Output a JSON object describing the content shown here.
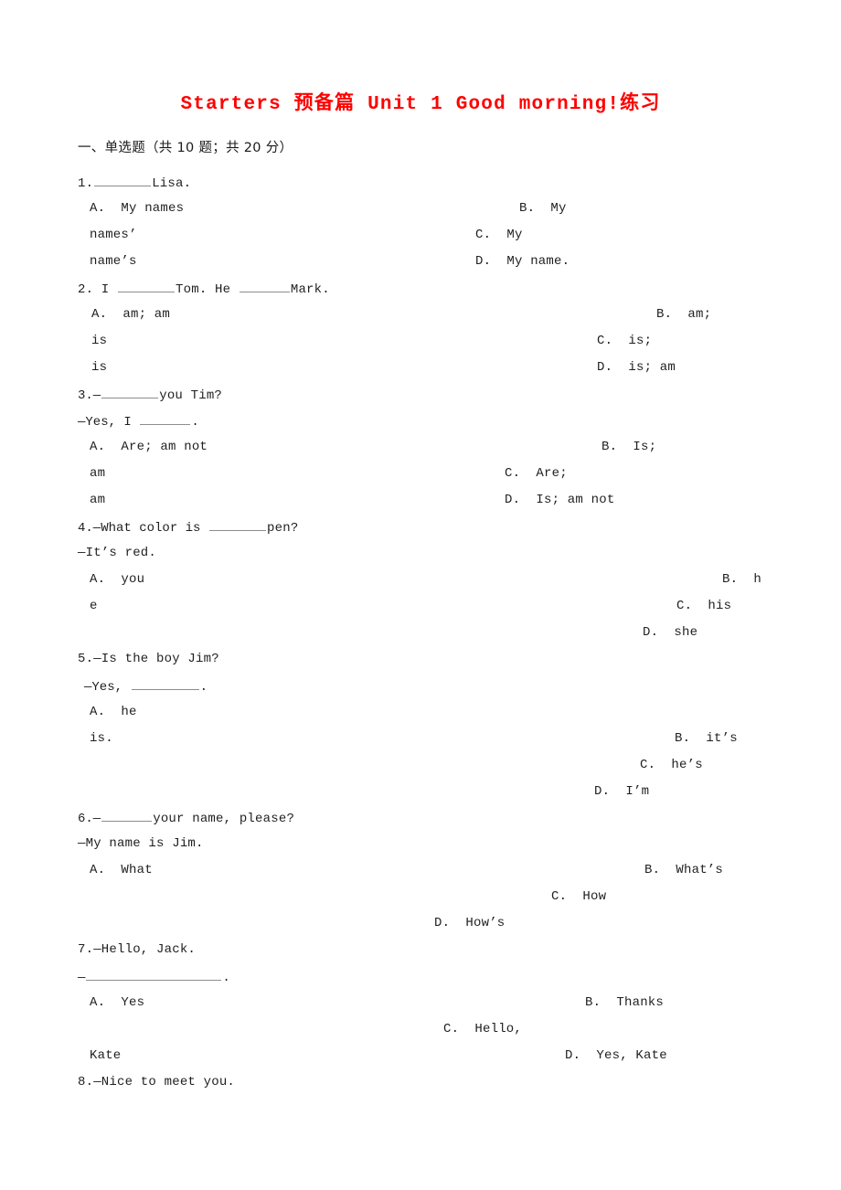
{
  "document": {
    "title": "Starters 预备篇 Unit 1 Good morning!练习",
    "title_color": "#ff0000",
    "section_header": "一、单选题（共 10 题；共 20 分）"
  },
  "questions": [
    {
      "number": "1.",
      "stem_prefix": "1.",
      "stem_suffix": "Lisa.",
      "fragments": {
        "a_label": "A.",
        "a_text": "My names",
        "a_cont": "names’",
        "a_cont2": "name’s",
        "b_label": "B.",
        "b_text": "My",
        "c_label": "C.",
        "c_text": "My",
        "d_label": "D.",
        "d_text": "My name."
      }
    },
    {
      "number": "2.",
      "stem_a": "2. I",
      "stem_b": "Tom. He",
      "stem_c": "Mark.",
      "fragments": {
        "a_label": "A.",
        "a_text": "am; am",
        "a_cont": "is",
        "a_cont2": "is",
        "b_label": "B.",
        "b_text": "am;",
        "c_label": "C.",
        "c_text": "is;",
        "d_label": "D.",
        "d_text": "is; am"
      }
    },
    {
      "number": "3.",
      "stem_a": "3.—",
      "stem_b": "you Tim?",
      "stem_c": "—Yes, I",
      "stem_d": ".",
      "fragments": {
        "a_label": "A.",
        "a_text": "Are; am not",
        "a_cont": "am",
        "a_cont2": "am",
        "b_label": "B.",
        "b_text": "Is;",
        "c_label": "C.",
        "c_text": "Are;",
        "d_label": "D.",
        "d_text": "Is; am not"
      }
    },
    {
      "number": "4.",
      "stem_a": "4.—What color is",
      "stem_b": "pen?",
      "stem_c": "—It’s red.",
      "fragments": {
        "a_label": "A.",
        "a_text": "you",
        "a_cont": "e",
        "b_label": "B.",
        "b_text": "h",
        "c_label": "C.",
        "c_text": "his",
        "d_label": "D.",
        "d_text": "she"
      }
    },
    {
      "number": "5.",
      "stem_a": "5.—Is the boy Jim?",
      "stem_b": "—Yes,",
      "stem_c": ".",
      "fragments": {
        "a_label": "A.",
        "a_text": "he",
        "a_cont": "is.",
        "b_label": "B.",
        "b_text": "it’s",
        "c_label": "C.",
        "c_text": "he’s",
        "d_label": "D.",
        "d_text": "I’m"
      }
    },
    {
      "number": "6.",
      "stem_a": "6.—",
      "stem_b": "your name, please?",
      "stem_c": "—My name is Jim.",
      "fragments": {
        "a_label": "A.",
        "a_text": "What",
        "b_label": "B.",
        "b_text": "What’s",
        "c_label": "C.",
        "c_text": "How",
        "d_label": "D.",
        "d_text": "How’s"
      }
    },
    {
      "number": "7.",
      "stem_a": "7.—Hello, Jack.",
      "stem_b": "—",
      "stem_c": ".",
      "fragments": {
        "a_label": "A.",
        "a_text": "Yes",
        "b_label": "B.",
        "b_text": "Thanks",
        "c_label": "C.",
        "c_text": "Hello,",
        "c_cont": "Kate",
        "d_label": "D.",
        "d_text": "Yes, Kate"
      }
    },
    {
      "number": "8.",
      "stem_a": "8.—Nice to meet you."
    }
  ]
}
